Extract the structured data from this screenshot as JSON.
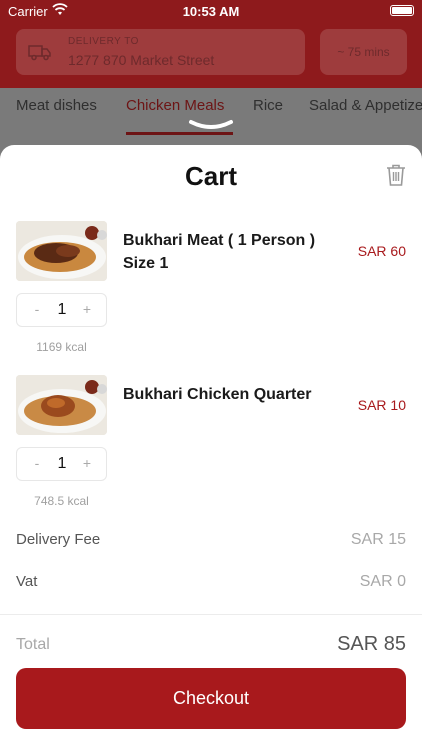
{
  "status_bar": {
    "carrier": "Carrier",
    "time": "10:53 AM"
  },
  "header": {
    "delivery_label": "DELIVERY TO",
    "address": "1277 870 Market Street",
    "eta": "~ 75 mins"
  },
  "tabs": [
    {
      "label": "Meat dishes"
    },
    {
      "label": "Chicken Meals",
      "active": true
    },
    {
      "label": "Rice"
    },
    {
      "label": "Salad & Appetize"
    }
  ],
  "cart": {
    "title": "Cart",
    "items": [
      {
        "name": "Bukhari Meat ( 1 Person ) Size 1",
        "price": "SAR 60",
        "quantity": "1",
        "calories": "1169 kcal"
      },
      {
        "name": "Bukhari Chicken Quarter",
        "price": "SAR 10",
        "quantity": "1",
        "calories": "748.5 kcal"
      }
    ],
    "stepper": {
      "minus": "-",
      "plus": "+"
    },
    "summary": {
      "delivery_fee_label": "Delivery Fee",
      "delivery_fee": "SAR 15",
      "vat_label": "Vat",
      "vat": "SAR 0",
      "total_label": "Total",
      "total": "SAR 85"
    },
    "checkout_label": "Checkout"
  },
  "colors": {
    "brand": "#a8191c",
    "header": "#8e1a1c",
    "overlay": "#7a7a7a"
  },
  "icons": {
    "trash": "trash-icon",
    "truck": "delivery-truck-icon",
    "wifi": "wifi-icon",
    "battery": "battery-icon"
  }
}
